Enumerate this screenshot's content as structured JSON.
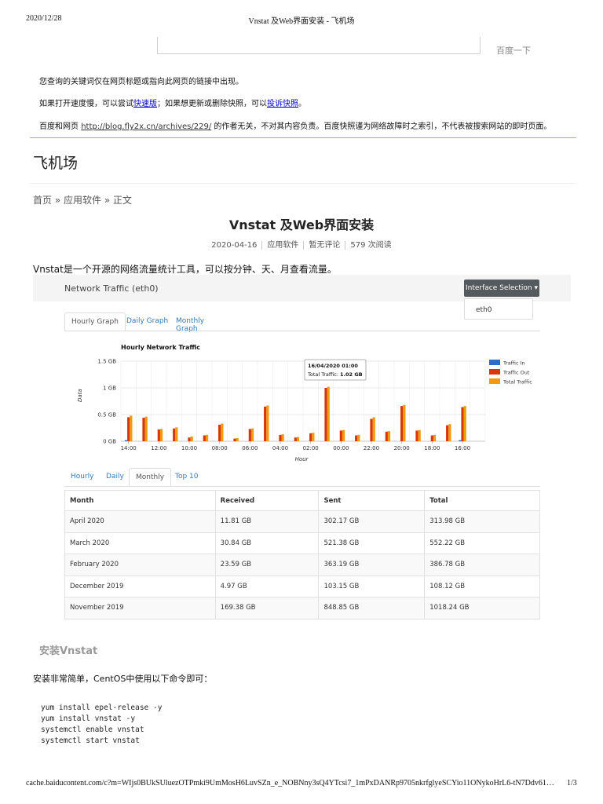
{
  "print_header": {
    "date": "2020/12/28",
    "title": "Vnstat 及Web界面安装 - 飞机场"
  },
  "search": {
    "button_label": "百度一下"
  },
  "notice": {
    "line1": "您查询的关键词仅在网页标题或指向此网页的链接中出现。",
    "line2_pre": "如果打开速度慢，可以尝试",
    "line2_link1": "快速版",
    "line2_mid": "；如果想更新或删除快照，可以",
    "line2_link2": "投诉快照",
    "line2_post": "。",
    "line3_pre": "百度和网页 ",
    "line3_url": "http://blog.fly2x.cn/archives/229/",
    "line3_post": " 的作者无关，不对其内容负责。百度快照谨为网络故障时之索引，不代表被搜索网站的即时页面。"
  },
  "site": {
    "title": "飞机场"
  },
  "breadcrumb": {
    "home": "首页",
    "sep": " » ",
    "category": "应用软件",
    "current": "正文"
  },
  "post": {
    "title": "Vnstat 及Web界面安装",
    "date": "2020-04-16",
    "category": "应用软件",
    "comments": "暂无评论",
    "views": "579 次阅读",
    "intro": "Vnstat是一个开源的网络流量统计工具，可以按分钟、天、月查看流量。"
  },
  "screenshot": {
    "title": "Network Traffic (eth0)",
    "interface_button": "Interface Selection",
    "interface_option": "eth0",
    "graph_tabs": [
      "Hourly Graph",
      "Daily Graph",
      "Monthly Graph"
    ],
    "table_tabs": [
      "Hourly",
      "Daily",
      "Monthly",
      "Top 10"
    ],
    "table": {
      "headers": [
        "Month",
        "Received",
        "Sent",
        "Total"
      ],
      "rows": [
        [
          "April 2020",
          "11.81 GB",
          "302.17 GB",
          "313.98 GB"
        ],
        [
          "March 2020",
          "30.84 GB",
          "521.38 GB",
          "552.22 GB"
        ],
        [
          "February 2020",
          "23.59 GB",
          "363.19 GB",
          "386.78 GB"
        ],
        [
          "December 2019",
          "4.97 GB",
          "103.15 GB",
          "108.12 GB"
        ],
        [
          "November 2019",
          "169.38 GB",
          "848.85 GB",
          "1018.24 GB"
        ]
      ]
    }
  },
  "chart_data": {
    "type": "bar",
    "title": "Hourly Network Traffic",
    "xlabel": "Hour",
    "ylabel": "Data",
    "ylim": [
      0,
      1.5
    ],
    "yticks": [
      "0 GB",
      "0.5 GB",
      "1 GB",
      "1.5 GB"
    ],
    "tick_labels": [
      "14:00",
      "12:00",
      "10:00",
      "08:00",
      "06:00",
      "04:00",
      "02:00",
      "00:00",
      "22:00",
      "20:00",
      "18:00",
      "16:00"
    ],
    "grid": true,
    "legend": "right",
    "tooltip": {
      "line1": "16/04/2020 01:00",
      "line2_label": "Total Traffic: ",
      "line2_value": "1.02 GB"
    },
    "colors": {
      "in": "#2f6cc9",
      "out": "#d9360b",
      "total": "#f29a0d"
    },
    "series": [
      {
        "name": "Traffic In",
        "values": [
          0.02,
          0,
          0,
          0,
          0,
          0,
          0,
          0,
          0,
          0,
          0,
          0,
          0,
          0,
          0,
          0,
          0,
          0,
          0,
          0,
          0,
          0,
          0.02,
          0
        ]
      },
      {
        "name": "Traffic Out",
        "values": [
          0.45,
          0.44,
          0.22,
          0.24,
          0.07,
          0.11,
          0.31,
          0.05,
          0.23,
          0.65,
          0.12,
          0.07,
          0.15,
          1.0,
          0.2,
          0.11,
          0.42,
          0.18,
          0.66,
          0.2,
          0.11,
          0.3,
          0.64,
          0
        ]
      },
      {
        "name": "Total Traffic",
        "values": [
          0.48,
          0.46,
          0.23,
          0.26,
          0.09,
          0.12,
          0.33,
          0.06,
          0.24,
          0.67,
          0.13,
          0.08,
          0.16,
          1.02,
          0.21,
          0.12,
          0.45,
          0.19,
          0.68,
          0.21,
          0.12,
          0.32,
          0.66,
          0
        ]
      }
    ]
  },
  "install": {
    "heading": "安装Vnstat",
    "text": "安装非常简单，CentOS中使用以下命令即可：",
    "code": "yum install epel-release -y\nyum install vnstat -y\nsystemctl enable vnstat\nsystemctl start vnstat"
  },
  "print_footer": {
    "url": "cache.baiducontent.com/c?m=WIjs0BUkSUluezOTPmki9UmMosH6LuvSZn_e_NOBNny3sQ4YTcsi7_1mPxDANRp9705nkrfglyeSCYio11ONykoHrL6-tN7Ddv61…",
    "page": "1/3"
  }
}
